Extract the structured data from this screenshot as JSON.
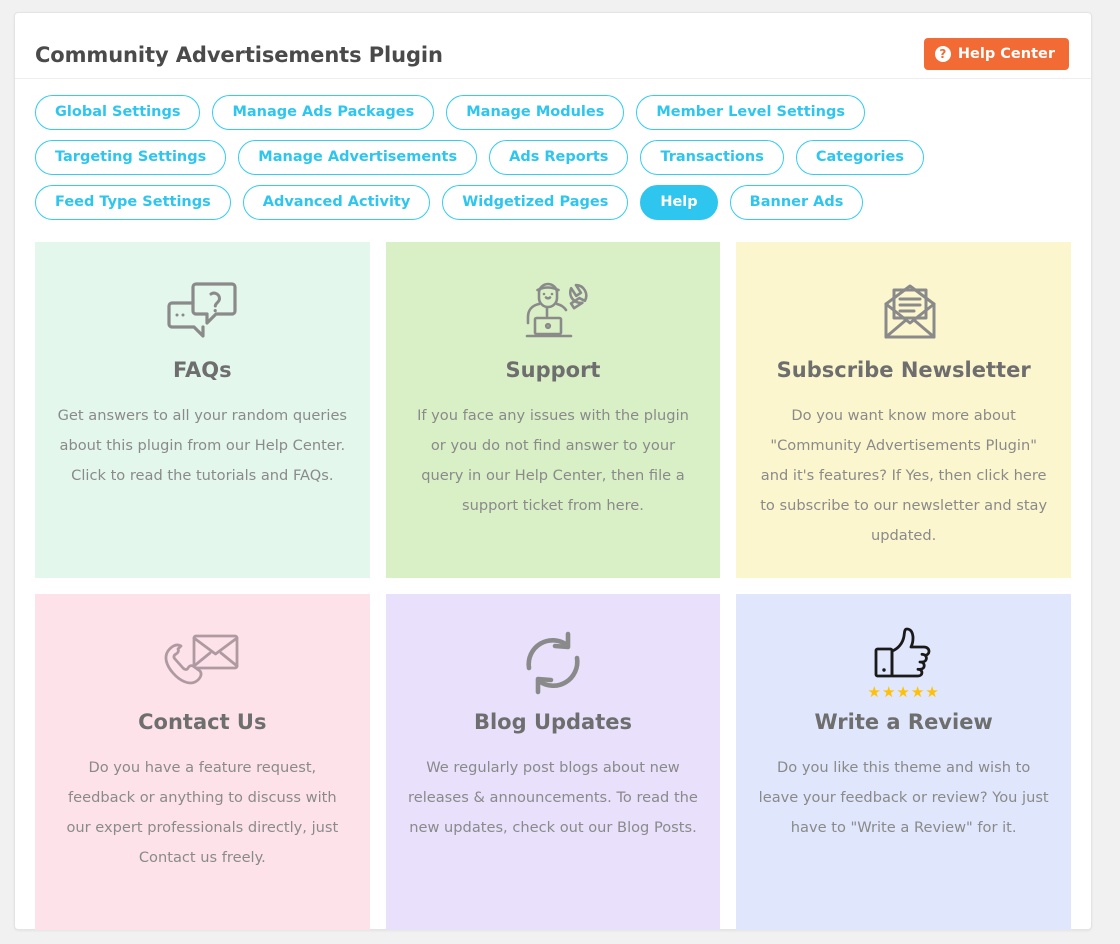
{
  "header": {
    "title": "Community Advertisements Plugin",
    "help_center_label": "Help Center",
    "help_center_icon": "question-circle-icon",
    "help_center_color": "#f26a34"
  },
  "theme": {
    "accent": "#2ec6ef",
    "title_color": "#4a4a4a",
    "card_title_color": "#6e6e6e",
    "card_text_color": "#8a8a8a",
    "star_color": "#ffc107"
  },
  "tabs": [
    {
      "label": "Global Settings",
      "active": false
    },
    {
      "label": "Manage Ads Packages",
      "active": false
    },
    {
      "label": "Manage Modules",
      "active": false
    },
    {
      "label": "Member Level Settings",
      "active": false
    },
    {
      "label": "Targeting Settings",
      "active": false
    },
    {
      "label": "Manage Advertisements",
      "active": false
    },
    {
      "label": "Ads Reports",
      "active": false
    },
    {
      "label": "Transactions",
      "active": false
    },
    {
      "label": "Categories",
      "active": false
    },
    {
      "label": "Feed Type Settings",
      "active": false
    },
    {
      "label": "Advanced Activity",
      "active": false
    },
    {
      "label": "Widgetized Pages",
      "active": false
    },
    {
      "label": "Help",
      "active": true
    },
    {
      "label": "Banner Ads",
      "active": false
    }
  ],
  "cards": [
    {
      "title": "FAQs",
      "icon": "speech-bubbles-question-icon",
      "text": "Get answers to all your random queries about this plugin from our Help Center. Click to read the tutorials and FAQs.",
      "background": "#e3f7ed"
    },
    {
      "title": "Support",
      "icon": "support-agent-laptop-wrench-icon",
      "text": "If you face any issues with the plugin or you do not find answer to your query in our Help Center, then file a support ticket from here.",
      "background": "#d9f0c6"
    },
    {
      "title": "Subscribe Newsletter",
      "icon": "open-envelope-letter-icon",
      "text": "Do you want know more about \"Community Advertisements Plugin\" and it's features? If Yes, then click here to subscribe to our newsletter and stay updated.",
      "background": "#fcf6ce"
    },
    {
      "title": "Contact Us",
      "icon": "phone-envelope-icon",
      "text": "Do you have a feature request, feedback or anything to discuss with our expert professionals directly, just Contact us freely.",
      "background": "#fde3e9"
    },
    {
      "title": "Blog Updates",
      "icon": "refresh-sync-arrows-icon",
      "text": "We regularly post blogs about new releases & announcements. To read the new updates, check out our Blog Posts.",
      "background": "#e9e0fb"
    },
    {
      "title": "Write a Review",
      "icon": "thumbs-up-stars-icon",
      "text": "Do you like this theme and wish to leave your feedback or review? You just have to \"Write a Review\" for it.",
      "background": "#e0e6fb",
      "stars": "★★★★★"
    }
  ]
}
